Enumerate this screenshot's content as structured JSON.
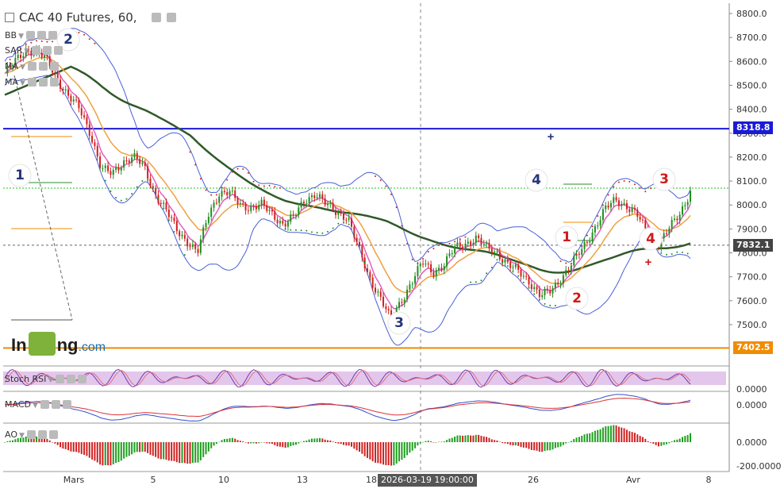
{
  "header": {
    "title": "CAC 40 Futures, 60,"
  },
  "indicators_top": [
    "BB",
    "SAR",
    "MA",
    "MA"
  ],
  "indicators_sub": [
    "Stoch RSI",
    "MACD",
    "AO"
  ],
  "logo": {
    "left": "In",
    "right": "ng",
    "suffix": ".com"
  },
  "chart_data": [
    {
      "type": "candlestick",
      "ylim": [
        7400,
        8850
      ],
      "y_ticks": [
        "8800.0",
        "8700.0",
        "8600.0",
        "8500.0",
        "8400.0",
        "8300.0",
        "8200.0",
        "8100.0",
        "8000.0",
        "7900.0",
        "7800.0",
        "7700.0",
        "7600.0",
        "7500.0"
      ],
      "x_ticks": [
        "Mars",
        "5",
        "10",
        "13",
        "18",
        "26",
        "Avr",
        "8"
      ],
      "price_tags": [
        {
          "label": "8318.8",
          "value": 8318.8,
          "color": "#1a1ad6"
        },
        {
          "label": "7832.1",
          "value": 7832.1,
          "color": "#444444"
        },
        {
          "label": "7402.5",
          "value": 7402.5,
          "color": "#f08c00"
        }
      ],
      "crosshair_date": "2026-03-19 19:00:00",
      "close_path": [
        8550,
        8600,
        8650,
        8640,
        8600,
        8520,
        8450,
        8400,
        8300,
        8150,
        8130,
        8180,
        8200,
        8160,
        8050,
        7980,
        7900,
        7850,
        7800,
        7960,
        8050,
        8050,
        8000,
        7990,
        8000,
        7960,
        7920,
        7950,
        8020,
        8050,
        8000,
        7970,
        7950,
        7820,
        7700,
        7620,
        7520,
        7600,
        7680,
        7760,
        7720,
        7750,
        7820,
        7840,
        7860,
        7820,
        7800,
        7750,
        7720,
        7680,
        7620,
        7640,
        7700,
        7760,
        7820,
        7900,
        7980,
        8020,
        8000,
        7960,
        7880,
        7840,
        7900,
        7960,
        8060
      ],
      "wave_labels": [
        {
          "text": "1",
          "color": "#27367a"
        },
        {
          "text": "2",
          "color": "#27367a"
        },
        {
          "text": "3",
          "color": "#27367a"
        },
        {
          "text": "4",
          "color": "#27367a"
        },
        {
          "text": "1",
          "color": "#d11a1a"
        },
        {
          "text": "2",
          "color": "#d11a1a"
        },
        {
          "text": "3",
          "color": "#d11a1a"
        },
        {
          "text": "4",
          "color": "#d11a1a"
        }
      ]
    },
    {
      "type": "area",
      "title": "Stoch RSI",
      "band": [
        20,
        80
      ]
    },
    {
      "type": "line",
      "title": "MACD",
      "y_ticks": [
        "0.0000"
      ]
    },
    {
      "type": "bar",
      "title": "AO",
      "y_ticks": [
        "0.0000",
        "-200.0000"
      ]
    }
  ]
}
